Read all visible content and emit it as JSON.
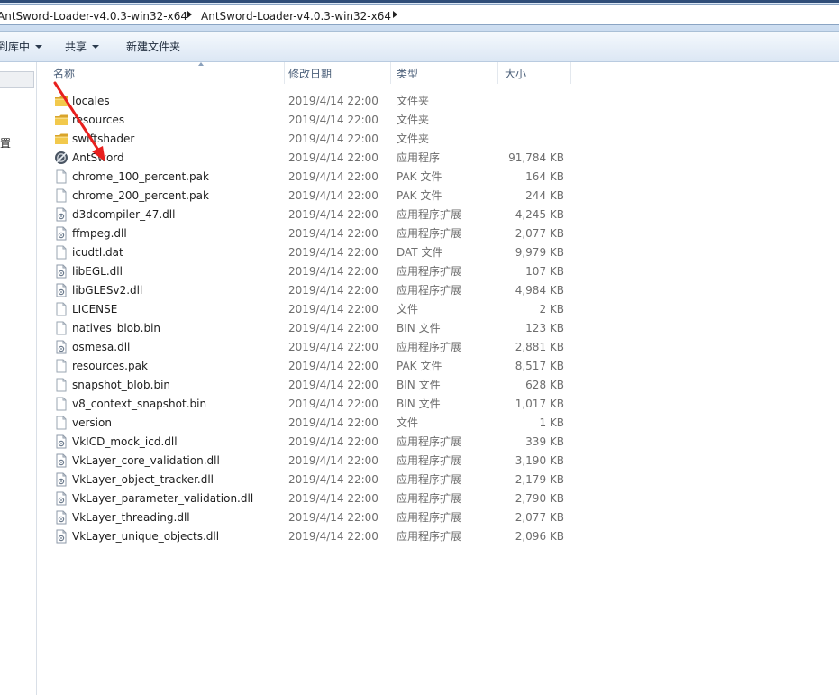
{
  "address": {
    "crumbs": [
      "AntSword-Loader-v4.0.3-win32-x64",
      "AntSword-Loader-v4.0.3-win32-x64"
    ]
  },
  "toolbar": {
    "include_label": "包含到库中",
    "share_label": "共享",
    "new_folder_label": "新建文件夹"
  },
  "nav": {
    "partial_item": "位置"
  },
  "columns": {
    "name": "名称",
    "date": "修改日期",
    "type": "类型",
    "size": "大小"
  },
  "files": [
    {
      "name": "locales",
      "date": "2019/4/14 22:00",
      "type": "文件夹",
      "size": "",
      "icon": "folder-icon"
    },
    {
      "name": "resources",
      "date": "2019/4/14 22:00",
      "type": "文件夹",
      "size": "",
      "icon": "folder-icon"
    },
    {
      "name": "swiftshader",
      "date": "2019/4/14 22:00",
      "type": "文件夹",
      "size": "",
      "icon": "folder-icon"
    },
    {
      "name": "AntSword",
      "date": "2019/4/14 22:00",
      "type": "应用程序",
      "size": "91,784 KB",
      "icon": "app-icon"
    },
    {
      "name": "chrome_100_percent.pak",
      "date": "2019/4/14 22:00",
      "type": "PAK 文件",
      "size": "164 KB",
      "icon": "file-icon"
    },
    {
      "name": "chrome_200_percent.pak",
      "date": "2019/4/14 22:00",
      "type": "PAK 文件",
      "size": "244 KB",
      "icon": "file-icon"
    },
    {
      "name": "d3dcompiler_47.dll",
      "date": "2019/4/14 22:00",
      "type": "应用程序扩展",
      "size": "4,245 KB",
      "icon": "dll-icon"
    },
    {
      "name": "ffmpeg.dll",
      "date": "2019/4/14 22:00",
      "type": "应用程序扩展",
      "size": "2,077 KB",
      "icon": "dll-icon"
    },
    {
      "name": "icudtl.dat",
      "date": "2019/4/14 22:00",
      "type": "DAT 文件",
      "size": "9,979 KB",
      "icon": "file-icon"
    },
    {
      "name": "libEGL.dll",
      "date": "2019/4/14 22:00",
      "type": "应用程序扩展",
      "size": "107 KB",
      "icon": "dll-icon"
    },
    {
      "name": "libGLESv2.dll",
      "date": "2019/4/14 22:00",
      "type": "应用程序扩展",
      "size": "4,984 KB",
      "icon": "dll-icon"
    },
    {
      "name": "LICENSE",
      "date": "2019/4/14 22:00",
      "type": "文件",
      "size": "2 KB",
      "icon": "file-icon"
    },
    {
      "name": "natives_blob.bin",
      "date": "2019/4/14 22:00",
      "type": "BIN 文件",
      "size": "123 KB",
      "icon": "file-icon"
    },
    {
      "name": "osmesa.dll",
      "date": "2019/4/14 22:00",
      "type": "应用程序扩展",
      "size": "2,881 KB",
      "icon": "dll-icon"
    },
    {
      "name": "resources.pak",
      "date": "2019/4/14 22:00",
      "type": "PAK 文件",
      "size": "8,517 KB",
      "icon": "file-icon"
    },
    {
      "name": "snapshot_blob.bin",
      "date": "2019/4/14 22:00",
      "type": "BIN 文件",
      "size": "628 KB",
      "icon": "file-icon"
    },
    {
      "name": "v8_context_snapshot.bin",
      "date": "2019/4/14 22:00",
      "type": "BIN 文件",
      "size": "1,017 KB",
      "icon": "file-icon"
    },
    {
      "name": "version",
      "date": "2019/4/14 22:00",
      "type": "文件",
      "size": "1 KB",
      "icon": "file-icon"
    },
    {
      "name": "VkICD_mock_icd.dll",
      "date": "2019/4/14 22:00",
      "type": "应用程序扩展",
      "size": "339 KB",
      "icon": "dll-icon"
    },
    {
      "name": "VkLayer_core_validation.dll",
      "date": "2019/4/14 22:00",
      "type": "应用程序扩展",
      "size": "3,190 KB",
      "icon": "dll-icon"
    },
    {
      "name": "VkLayer_object_tracker.dll",
      "date": "2019/4/14 22:00",
      "type": "应用程序扩展",
      "size": "2,179 KB",
      "icon": "dll-icon"
    },
    {
      "name": "VkLayer_parameter_validation.dll",
      "date": "2019/4/14 22:00",
      "type": "应用程序扩展",
      "size": "2,790 KB",
      "icon": "dll-icon"
    },
    {
      "name": "VkLayer_threading.dll",
      "date": "2019/4/14 22:00",
      "type": "应用程序扩展",
      "size": "2,077 KB",
      "icon": "dll-icon"
    },
    {
      "name": "VkLayer_unique_objects.dll",
      "date": "2019/4/14 22:00",
      "type": "应用程序扩展",
      "size": "2,096 KB",
      "icon": "dll-icon"
    }
  ],
  "colors": {
    "annotation_arrow": "#e8201e",
    "folder": "#e8b93e"
  }
}
